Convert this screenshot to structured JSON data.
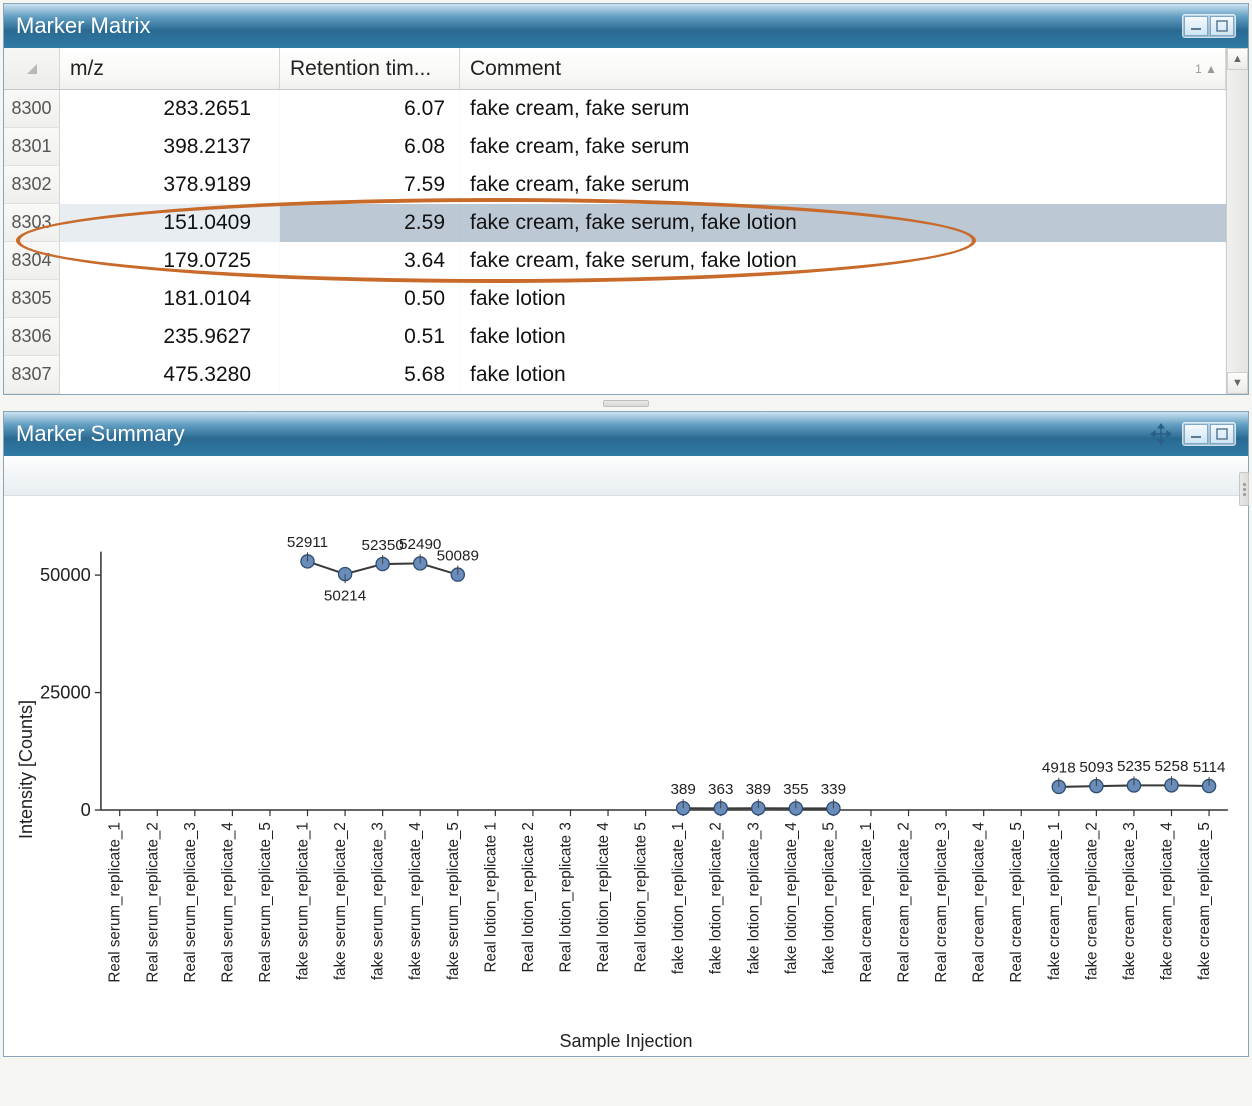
{
  "panels": {
    "matrix": {
      "title": "Marker Matrix"
    },
    "summary": {
      "title": "Marker Summary"
    }
  },
  "table": {
    "headers": {
      "mz": "m/z",
      "rt": "Retention tim...",
      "comment": "Comment"
    },
    "sort_header": "comment",
    "selected_index": 3,
    "highlighted_indices": [
      3,
      4
    ],
    "rows": [
      {
        "id": "8300",
        "mz": "283.2651",
        "rt": "6.07",
        "comment": "fake cream, fake serum"
      },
      {
        "id": "8301",
        "mz": "398.2137",
        "rt": "6.08",
        "comment": "fake cream, fake serum"
      },
      {
        "id": "8302",
        "mz": "378.9189",
        "rt": "7.59",
        "comment": "fake cream, fake serum"
      },
      {
        "id": "8303",
        "mz": "151.0409",
        "rt": "2.59",
        "comment": "fake cream, fake serum, fake lotion"
      },
      {
        "id": "8304",
        "mz": "179.0725",
        "rt": "3.64",
        "comment": "fake cream, fake serum, fake lotion"
      },
      {
        "id": "8305",
        "mz": "181.0104",
        "rt": "0.50",
        "comment": "fake lotion"
      },
      {
        "id": "8306",
        "mz": "235.9627",
        "rt": "0.51",
        "comment": "fake lotion"
      },
      {
        "id": "8307",
        "mz": "475.3280",
        "rt": "5.68",
        "comment": "fake lotion"
      }
    ]
  },
  "chart_data": {
    "type": "scatter",
    "ylabel": "Intensity [Counts]",
    "xlabel": "Sample Injection",
    "ylim": [
      0,
      55000
    ],
    "yticks": [
      0,
      25000,
      50000
    ],
    "categories": [
      "Real serum_replicate_1",
      "Real serum_replicate_2",
      "Real serum_replicate_3",
      "Real serum_replicate_4",
      "Real serum_replicate_5",
      "fake serum_replicate_1",
      "fake serum_replicate_2",
      "fake serum_replicate_3",
      "fake serum_replicate_4",
      "fake serum_replicate_5",
      "Real lotion_replicate 1",
      "Real lotion_replicate 2",
      "Real lotion_replicate 3",
      "Real lotion_replicate 4",
      "Real lotion_replicate 5",
      "fake lotion_replicate_1",
      "fake lotion_replicate_2",
      "fake lotion_replicate_3",
      "fake lotion_replicate_4",
      "fake lotion_replicate_5",
      "Real cream_replicate_1",
      "Real cream_replicate_2",
      "Real cream_replicate_3",
      "Real cream_replicate_4",
      "Real cream_replicate_5",
      "fake cream_replicate_1",
      "fake cream_replicate_2",
      "fake cream_replicate_3",
      "fake cream_replicate_4",
      "fake cream_replicate_5"
    ],
    "values": [
      null,
      null,
      null,
      null,
      null,
      52911,
      50214,
      52350,
      52490,
      50089,
      null,
      null,
      null,
      null,
      null,
      389,
      363,
      389,
      355,
      339,
      null,
      null,
      null,
      null,
      null,
      4918,
      5093,
      5235,
      5258,
      5114
    ],
    "label_positions": [
      "t",
      "b",
      "t",
      "t",
      "t",
      "t",
      "t",
      "t",
      "t",
      "t",
      "t",
      "t",
      "t",
      "t",
      "t"
    ]
  },
  "colors": {
    "marker_fill": "#6a8cbb",
    "marker_stroke": "#2d4d72",
    "axis": "#333333",
    "annotation": "#c86a2a"
  }
}
